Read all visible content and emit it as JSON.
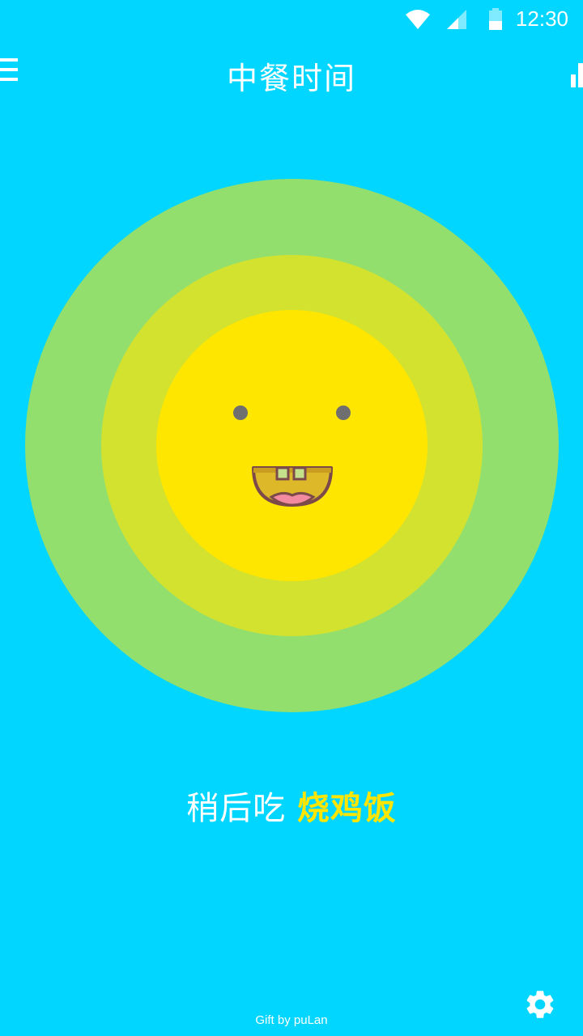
{
  "status_bar": {
    "time": "12:30",
    "icons": [
      "wifi-icon",
      "cell-signal-icon",
      "battery-icon"
    ]
  },
  "app_bar": {
    "title": "中餐时间",
    "menu_icon": "hamburger-menu-icon",
    "action_icon": "bar-chart-icon"
  },
  "meal_display": {
    "prefix": "稍后吃",
    "dish": "烧鸡饭"
  },
  "footer": {
    "credit": "Gift by puLan",
    "settings_icon": "gear-icon"
  },
  "colors": {
    "background": "#00d6ff",
    "ring_outer": "#93df6e",
    "ring_middle": "#d3e22f",
    "face": "#ffe600",
    "dish_highlight": "#ffe600"
  }
}
